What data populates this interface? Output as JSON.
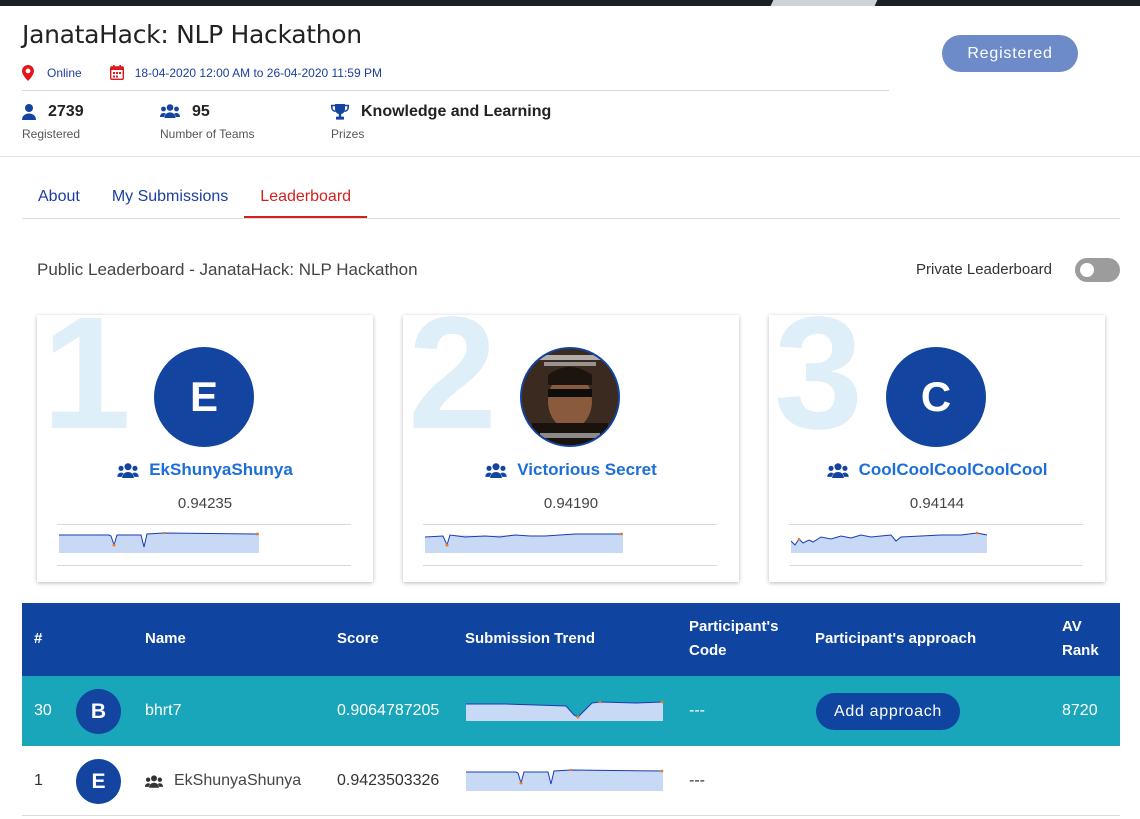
{
  "event": {
    "title": "JanataHack: NLP Hackathon",
    "location": "Online",
    "dates": "18-04-2020 12:00 AM to 26-04-2020 11:59 PM",
    "registered_count": "2739",
    "registered_label": "Registered",
    "teams_count": "95",
    "teams_label": "Number of Teams",
    "prize_value": "Knowledge and Learning",
    "prize_label": "Prizes",
    "register_button": "Registered"
  },
  "tabs": [
    {
      "label": "About",
      "active": false
    },
    {
      "label": "My Submissions",
      "active": false
    },
    {
      "label": "Leaderboard",
      "active": true
    }
  ],
  "leaderboard": {
    "title": "Public Leaderboard - JanataHack: NLP Hackathon",
    "private_label": "Private Leaderboard",
    "private_enabled": false
  },
  "podium": [
    {
      "rank": "1",
      "avatar_letter": "E",
      "name": "EkShunyaShunya",
      "score": "0.94235"
    },
    {
      "rank": "2",
      "avatar_letter": "",
      "name": "Victorious Secret",
      "score": "0.94190"
    },
    {
      "rank": "3",
      "avatar_letter": "C",
      "name": "CoolCoolCoolCoolCool",
      "score": "0.94144"
    }
  ],
  "table": {
    "headers": {
      "rank": "#",
      "name": "Name",
      "score": "Score",
      "trend": "Submission Trend",
      "code_line1": "Participant's",
      "code_line2": "Code",
      "approach": "Participant's approach",
      "av_line1": "AV",
      "av_line2": "Rank"
    },
    "rows": [
      {
        "rank": "30",
        "avatar_letter": "B",
        "name": "bhrt7",
        "score": "0.9064787205",
        "code": "---",
        "approach_button": "Add approach",
        "av_rank": "8720"
      },
      {
        "rank": "1",
        "avatar_letter": "E",
        "name": "EkShunyaShunya",
        "score": "0.9423503326",
        "code": "---",
        "approach_button": "",
        "av_rank": ""
      }
    ]
  },
  "colors": {
    "primary": "#0f45a0",
    "highlight_row": "#19a5ba",
    "active_tab": "#d32020",
    "link": "#1d6fd8"
  }
}
